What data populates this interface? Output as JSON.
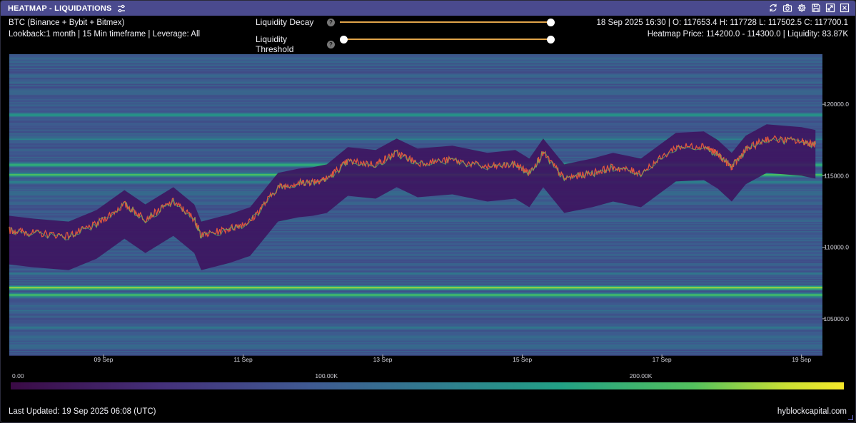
{
  "panel": {
    "title": "HEATMAP - LIQUIDATIONS",
    "settings_icon": "sliders-icon",
    "toolbar_icons": [
      "refresh-icon",
      "camera-icon",
      "gear-icon",
      "save-icon",
      "expand-icon",
      "close-icon"
    ]
  },
  "info": {
    "symbol": "BTC (Binance + Bybit + Bitmex)",
    "params": "Lookback:1 month | 15 Min timeframe | Leverage: All",
    "ohlc": "18 Sep 2025 16:30 | O: 117653.4 H: 117728 L: 117502.5 C: 117700.1",
    "heatmap": "Heatmap Price: 114200.0 - 114300.0 | Liquidity: 83.87K"
  },
  "controls": {
    "decay_label": "Liquidity Decay",
    "decay_value": 1.0,
    "threshold_label": "Liquidity Threshold",
    "threshold_range": [
      0.0,
      1.0
    ],
    "help_glyph": "?"
  },
  "colorbar": {
    "ticks": [
      "0.00",
      "100.00K",
      "200.00K"
    ],
    "tick_values": [
      0,
      100000,
      200000
    ],
    "max": 265000
  },
  "footer": {
    "updated": "Last Updated: 19 Sep 2025 06:08 (UTC)",
    "brand": "hyblockcapital.com"
  },
  "chart_data": {
    "type": "heatmap",
    "title": "",
    "xlabel": "",
    "ylabel": "",
    "x_ticks": [
      "09 Sep",
      "11 Sep",
      "13 Sep",
      "15 Sep",
      "17 Sep",
      "19 Sep"
    ],
    "x_tick_days": [
      9,
      11,
      13,
      15,
      17,
      19
    ],
    "x_range_days": [
      7.65,
      19.3
    ],
    "y_ticks": [
      105000,
      110000,
      115000,
      120000
    ],
    "y_tick_labels": [
      "105000.0",
      "110000.0",
      "115000.0",
      "120000.0"
    ],
    "y_range": [
      102500,
      123500
    ],
    "price_series": {
      "day": [
        7.65,
        8.0,
        8.5,
        8.9,
        9.3,
        9.6,
        10.0,
        10.3,
        10.4,
        10.8,
        11.1,
        11.5,
        11.8,
        12.0,
        12.2,
        12.5,
        12.9,
        13.2,
        13.5,
        14.0,
        14.5,
        14.9,
        15.1,
        15.3,
        15.6,
        16.0,
        16.3,
        16.7,
        17.2,
        17.6,
        17.8,
        18.0,
        18.2,
        18.5,
        19.0,
        19.2
      ],
      "price": [
        111200,
        111000,
        110800,
        111600,
        113000,
        112000,
        113200,
        112000,
        110800,
        111300,
        111800,
        114200,
        114500,
        114600,
        114800,
        116000,
        115800,
        116600,
        115900,
        116100,
        115600,
        115800,
        115200,
        116600,
        114800,
        115200,
        115600,
        115200,
        117000,
        117100,
        116500,
        115600,
        116800,
        117600,
        117400,
        117200
      ]
    },
    "high_liquidity_bands": [
      {
        "price": 121600,
        "level": 0.45
      },
      {
        "price": 119300,
        "level": 0.7
      },
      {
        "price": 117600,
        "level": 0.55
      },
      {
        "price": 115800,
        "level": 0.8
      },
      {
        "price": 115100,
        "level": 0.85
      },
      {
        "price": 114600,
        "level": 0.6
      },
      {
        "price": 113800,
        "level": 0.5
      },
      {
        "price": 108200,
        "level": 0.55
      },
      {
        "price": 107200,
        "level": 0.95
      },
      {
        "price": 106700,
        "level": 0.85
      },
      {
        "price": 105600,
        "level": 0.5
      },
      {
        "price": 104400,
        "level": 0.55
      },
      {
        "price": 103700,
        "level": 0.45
      }
    ]
  }
}
